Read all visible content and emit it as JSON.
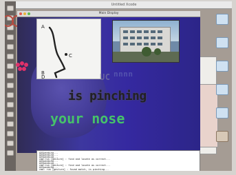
{
  "menubar": {
    "title": "Untitled Xcode"
  },
  "main_window": {
    "title": "Main Display"
  },
  "trace_panel": {
    "labels": [
      "A",
      "B",
      "C",
      "D"
    ]
  },
  "overlay": {
    "grey_caption": "is pinching",
    "green_caption": "your nose",
    "ghost_line_1": "UC",
    "ghost_line_2": "nnnn"
  },
  "terminal": {
    "lines": [
      "AXSpeaking...",
      "AXSpeaking...",
      "AXSpeaking...",
      "cmd:run [gesture] : find and locate as correct...",
      "AXSpeaking...",
      "AXSpeaking...",
      "cmd:run [gesture] : find and locate as correct...",
      "AXSpeaking...",
      "cmd: run [gesture] : found match, is pinching..."
    ]
  },
  "colors": {
    "accent_green": "#46c26a",
    "stage_blue": "#3d379f",
    "marker_pink": "#e0316a"
  }
}
